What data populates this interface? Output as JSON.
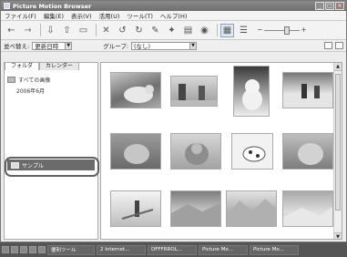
{
  "window": {
    "title": "Picture Motion Browser",
    "buttons": [
      "_",
      "□",
      "×"
    ]
  },
  "menu": [
    {
      "label": "ファイル(F)"
    },
    {
      "label": "編集(E)"
    },
    {
      "label": "表示(V)"
    },
    {
      "label": "活用(U)"
    },
    {
      "label": "ツール(T)"
    },
    {
      "label": "ヘルプ(H)"
    }
  ],
  "toolbar": {
    "icons": [
      "back-icon",
      "forward-icon",
      "import-icon",
      "export-icon",
      "print-icon",
      "delete-icon",
      "rotate-left-icon",
      "rotate-right-icon",
      "edit-icon",
      "enhance-icon",
      "album-icon",
      "disc-icon",
      "grid-view-icon",
      "list-view-icon"
    ]
  },
  "filterbar": {
    "sort_label": "並べ替え:",
    "sort_value": "更新日時",
    "group_label": "グループ:",
    "group_value": "(なし)"
  },
  "sidebar": {
    "tabs": [
      "フォルダ",
      "カレンダー"
    ],
    "items": [
      {
        "label": "すべての画像"
      },
      {
        "label": "2006年6月"
      }
    ],
    "selected": "サンプル"
  },
  "taskbar": {
    "items": [
      "便利ツール",
      "2 Internet...",
      "DFFFRROL...",
      "Picture Mo...",
      "Picture Mo..."
    ]
  }
}
